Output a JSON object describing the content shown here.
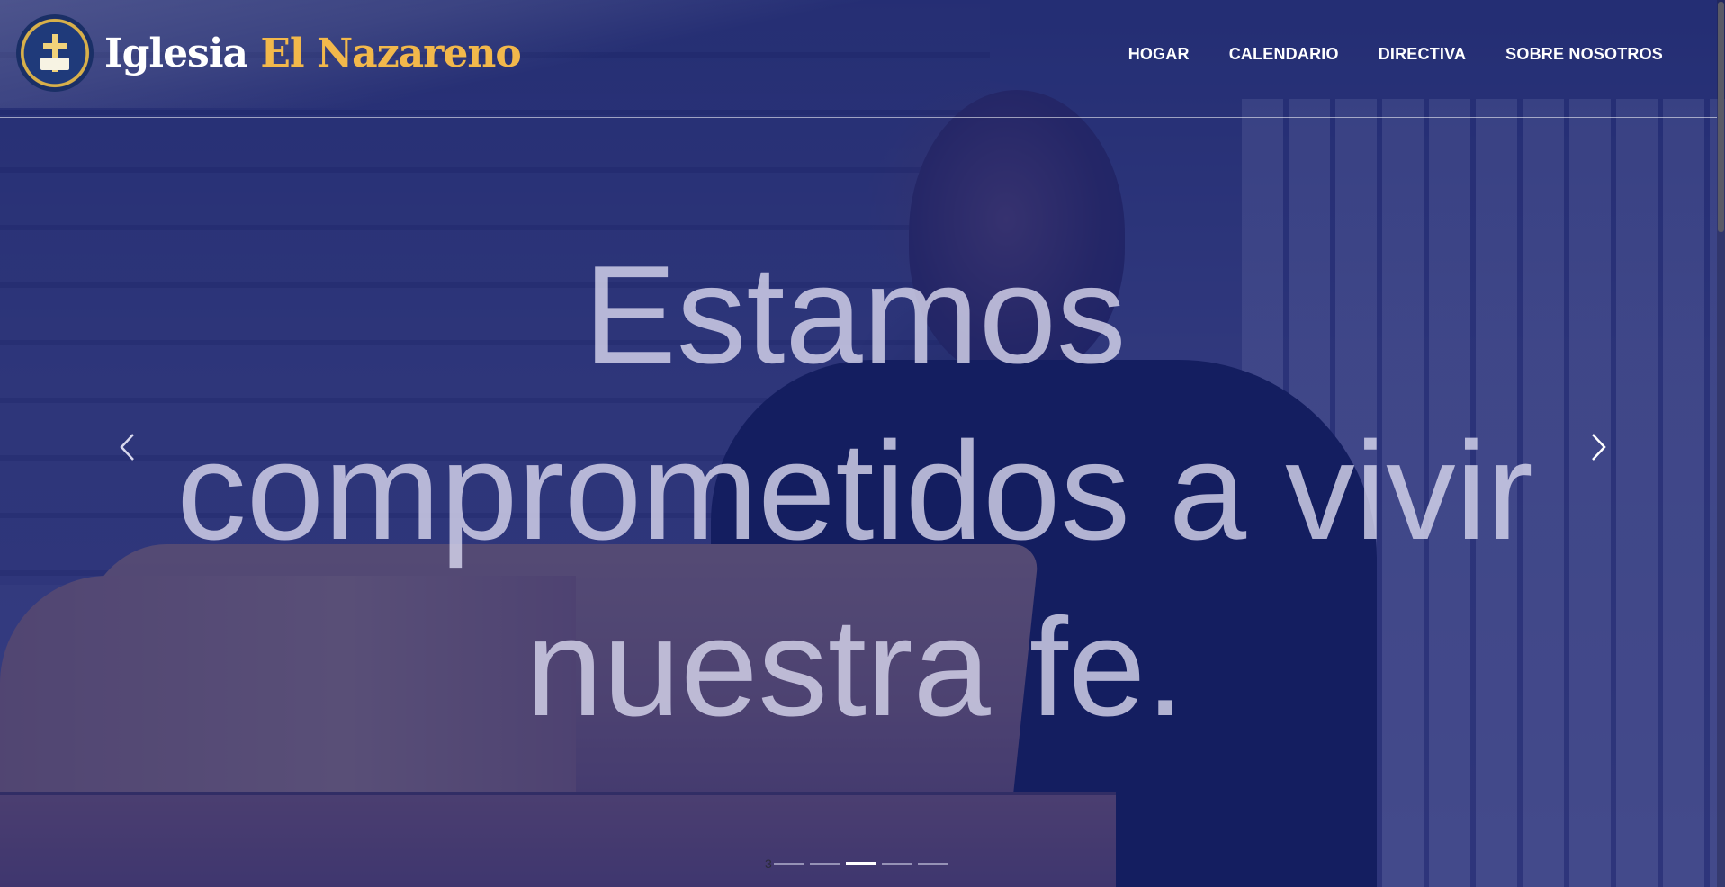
{
  "site": {
    "brand_word1": "Iglesia",
    "brand_word2": "El Nazareno",
    "logo_icon": "church-seal-logo",
    "accent_color": "#f2b84b",
    "overlay_color": "#162478"
  },
  "nav": {
    "items": [
      {
        "label": "HOGAR"
      },
      {
        "label": "CALENDARIO"
      },
      {
        "label": "DIRECTIVA"
      },
      {
        "label": "SOBRE NOSOTROS"
      }
    ]
  },
  "hero": {
    "headline": "Estamos comprometidos a vivir nuestra fe.",
    "prev_icon": "chevron-left-icon",
    "next_icon": "chevron-right-icon",
    "current_slide_number": "3",
    "slide_count": 5,
    "active_slide_index": 2
  }
}
